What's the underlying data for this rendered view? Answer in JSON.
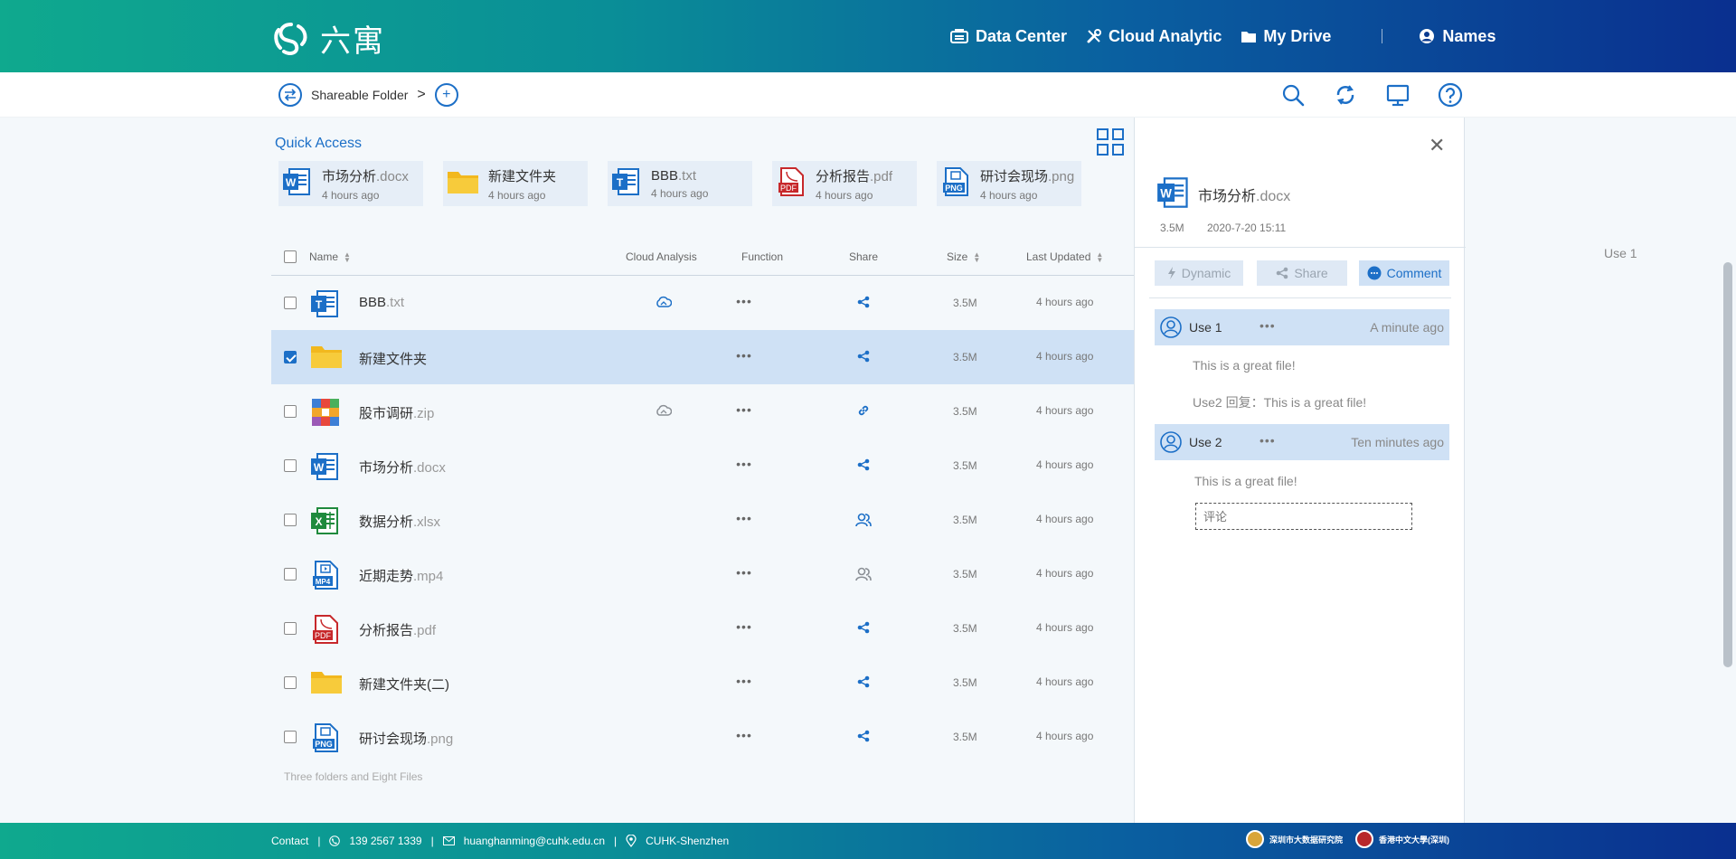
{
  "header": {
    "logo_text": "六寓",
    "nav": [
      {
        "label": "Data Center",
        "icon": "database-icon"
      },
      {
        "label": "Cloud Analytic",
        "icon": "tools-icon"
      },
      {
        "label": "My Drive",
        "icon": "folder-icon"
      }
    ],
    "user": {
      "label": "Names",
      "icon": "user-icon"
    }
  },
  "subheader": {
    "breadcrumb": "Shareable Folder",
    "separator": ">",
    "tools": [
      "search-icon",
      "refresh-icon",
      "monitor-icon",
      "help-icon"
    ]
  },
  "quick_access": {
    "title": "Quick Access",
    "items": [
      {
        "name": "市场分析",
        "ext": ".docx",
        "time": "4 hours ago",
        "icon": "word-icon"
      },
      {
        "name": "新建文件夹",
        "ext": "",
        "time": "4 hours ago",
        "icon": "folder-icon"
      },
      {
        "name": "BBB",
        "ext": ".txt",
        "time": "4 hours ago",
        "icon": "txt-icon"
      },
      {
        "name": "分析报告",
        "ext": ".pdf",
        "time": "4 hours ago",
        "icon": "pdf-icon"
      },
      {
        "name": "研讨会现场",
        "ext": ".png",
        "time": "4 hours ago",
        "icon": "png-icon"
      }
    ]
  },
  "table": {
    "columns": {
      "name": "Name",
      "cloud": "Cloud Analysis",
      "function": "Function",
      "share": "Share",
      "size": "Size",
      "updated": "Last Updated"
    },
    "rows": [
      {
        "name": "BBB",
        "ext": ".txt",
        "icon": "txt-icon",
        "cloud": true,
        "share_icon": "share-icon",
        "size": "3.5M",
        "time": "4 hours ago",
        "checked": false
      },
      {
        "name": "新建文件夹",
        "ext": "",
        "icon": "folder-icon",
        "cloud": false,
        "share_icon": "share-icon",
        "size": "3.5M",
        "time": "4 hours ago",
        "checked": true
      },
      {
        "name": "股市调研",
        "ext": ".zip",
        "icon": "zip-icon",
        "cloud": true,
        "cloud_muted": true,
        "share_icon": "link-icon",
        "size": "3.5M",
        "time": "4 hours ago",
        "checked": false
      },
      {
        "name": "市场分析",
        "ext": ".docx",
        "icon": "word-icon",
        "cloud": false,
        "share_icon": "share-icon",
        "size": "3.5M",
        "time": "4 hours ago",
        "checked": false
      },
      {
        "name": "数据分析",
        "ext": ".xlsx",
        "icon": "excel-icon",
        "cloud": false,
        "share_icon": "users-icon",
        "size": "3.5M",
        "time": "4 hours ago",
        "checked": false
      },
      {
        "name": "近期走势",
        "ext": ".mp4",
        "icon": "mp4-icon",
        "cloud": false,
        "share_icon": "users-icon",
        "share_muted": true,
        "size": "3.5M",
        "time": "4 hours ago",
        "checked": false
      },
      {
        "name": "分析报告",
        "ext": ".pdf",
        "icon": "pdf-icon",
        "cloud": false,
        "share_icon": "share-icon",
        "size": "3.5M",
        "time": "4 hours ago",
        "checked": false
      },
      {
        "name": "新建文件夹(二)",
        "ext": "",
        "icon": "folder-icon",
        "cloud": false,
        "share_icon": "share-icon",
        "size": "3.5M",
        "time": "4 hours ago",
        "checked": false
      },
      {
        "name": "研讨会现场",
        "ext": ".png",
        "icon": "png-icon",
        "cloud": false,
        "share_icon": "share-icon",
        "size": "3.5M",
        "time": "4 hours ago",
        "checked": false
      }
    ],
    "func_label": "•••",
    "summary": "Three folders and Eight Files"
  },
  "panel": {
    "title": "市场分析",
    "ext": ".docx",
    "size": "3.5M",
    "date": "2020-7-20 15:11",
    "buttons": [
      {
        "label": "Dynamic",
        "icon": "bolt-icon",
        "active": false
      },
      {
        "label": "Share",
        "icon": "share-icon",
        "active": false
      },
      {
        "label": "Comment",
        "icon": "comment-icon",
        "active": true
      }
    ],
    "comments": [
      {
        "user": "Use 1",
        "time": "A minute ago",
        "texts": [
          "This is a great file!",
          "Use2 回复：This is a great file!"
        ]
      },
      {
        "user": "Use 2",
        "time": "Ten minutes ago",
        "texts": [
          "This is a great file!"
        ]
      }
    ],
    "input_placeholder": "评论"
  },
  "outside_label": "Use 1",
  "footer": {
    "contact": "Contact",
    "phone": "139 2567 1339",
    "email": "huanghanming@cuhk.edu.cn",
    "location": "CUHK-Shenzhen",
    "logo1": "深圳市大数据研究院",
    "logo2": "香港中文大學(深圳)"
  },
  "colors": {
    "accent": "#1c6fc7",
    "header_start": "#0fa98e",
    "header_end": "#0a2f8f",
    "selected_row": "#cfe1f5"
  }
}
